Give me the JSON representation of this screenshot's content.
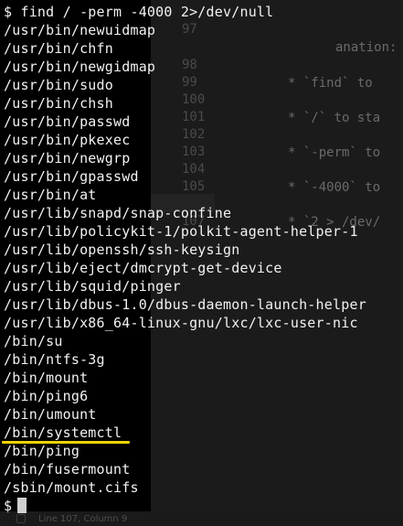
{
  "terminal": {
    "command_line": "$ find / -perm -4000 2>/dev/null",
    "output": [
      "/usr/bin/newuidmap",
      "/usr/bin/chfn",
      "/usr/bin/newgidmap",
      "/usr/bin/sudo",
      "/usr/bin/chsh",
      "/usr/bin/passwd",
      "/usr/bin/pkexec",
      "/usr/bin/newgrp",
      "/usr/bin/gpasswd",
      "/usr/bin/at",
      "/usr/lib/snapd/snap-confine",
      "/usr/lib/policykit-1/polkit-agent-helper-1",
      "/usr/lib/openssh/ssh-keysign",
      "/usr/lib/eject/dmcrypt-get-device",
      "/usr/lib/squid/pinger",
      "/usr/lib/dbus-1.0/dbus-daemon-launch-helper",
      "/usr/lib/x86_64-linux-gnu/lxc/lxc-user-nic",
      "/bin/su",
      "/bin/ntfs-3g",
      "/bin/mount",
      "/bin/ping6",
      "/bin/umount",
      "/bin/systemctl",
      "/bin/ping",
      "/bin/fusermount",
      "/sbin/mount.cifs"
    ],
    "prompt": "$",
    "highlighted_entry": "/bin/systemctl",
    "highlight_color": "#f2d300"
  },
  "editor": {
    "lines": [
      {
        "num": "97",
        "code": "anation:"
      },
      {
        "num": "98",
        "code": "* `find` to"
      },
      {
        "num": "99",
        "code": ""
      },
      {
        "num": "100",
        "code": "* `/` to sta"
      },
      {
        "num": "101",
        "code": ""
      },
      {
        "num": "102",
        "code": "* `-perm` to"
      },
      {
        "num": "103",
        "code": ""
      },
      {
        "num": "104",
        "code": "* `-4000` to"
      },
      {
        "num": "105",
        "code": ""
      },
      {
        "num": "106",
        "code": "* `2 > /dev/"
      },
      {
        "num": "107",
        "code": ""
      }
    ],
    "status": "Line 107, Column 9"
  }
}
